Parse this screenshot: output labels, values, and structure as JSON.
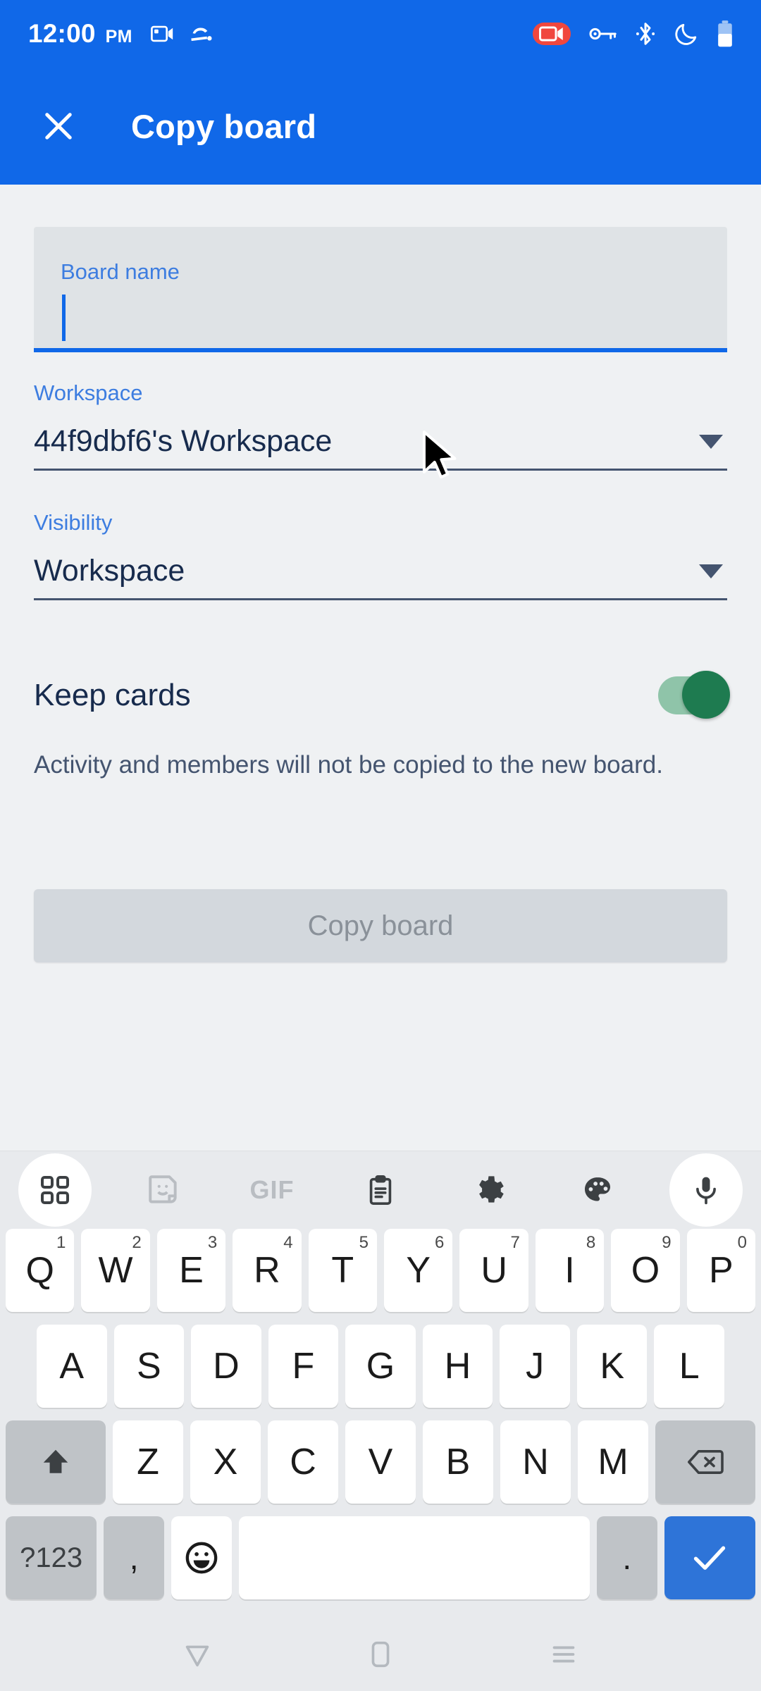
{
  "statusbar": {
    "time": "12:00",
    "ampm": "PM",
    "left_icons": [
      "video-camera-icon",
      "android-auto-icon"
    ],
    "right_icons": [
      "screen-record-icon",
      "vpn-key-icon",
      "bluetooth-icon",
      "do-not-disturb-moon-icon",
      "battery-icon"
    ],
    "accent_color": "#1068E8",
    "record_color": "#F0473E"
  },
  "appbar": {
    "close_label": "close-icon",
    "title": "Copy board"
  },
  "form": {
    "board_name": {
      "label": "Board name",
      "value": "",
      "focused": true
    },
    "workspace": {
      "label": "Workspace",
      "value": "44f9dbf6's Workspace"
    },
    "visibility": {
      "label": "Visibility",
      "value": "Workspace"
    },
    "keep_cards": {
      "label": "Keep cards",
      "enabled": true,
      "on_color": "#1E7B50",
      "track_color": "#8FC4A9"
    },
    "helper_text": "Activity and members will not be copied to the new board.",
    "submit": {
      "label": "Copy board",
      "enabled": false
    }
  },
  "keyboard": {
    "toolbar": [
      {
        "name": "grid-apps-icon",
        "circled": true
      },
      {
        "name": "sticker-icon",
        "circled": false
      },
      {
        "name": "gif-icon",
        "label": "GIF",
        "circled": false
      },
      {
        "name": "clipboard-icon",
        "circled": false
      },
      {
        "name": "gear-icon",
        "circled": false
      },
      {
        "name": "palette-icon",
        "circled": false
      },
      {
        "name": "microphone-icon",
        "circled": true
      }
    ],
    "row1": [
      {
        "key": "Q",
        "num": "1"
      },
      {
        "key": "W",
        "num": "2"
      },
      {
        "key": "E",
        "num": "3"
      },
      {
        "key": "R",
        "num": "4"
      },
      {
        "key": "T",
        "num": "5"
      },
      {
        "key": "Y",
        "num": "6"
      },
      {
        "key": "U",
        "num": "7"
      },
      {
        "key": "I",
        "num": "8"
      },
      {
        "key": "O",
        "num": "9"
      },
      {
        "key": "P",
        "num": "0"
      }
    ],
    "row2": [
      "A",
      "S",
      "D",
      "F",
      "G",
      "H",
      "J",
      "K",
      "L"
    ],
    "row3_letters": [
      "Z",
      "X",
      "C",
      "V",
      "B",
      "N",
      "M"
    ],
    "shift_label": "shift-icon",
    "backspace_label": "backspace-icon",
    "row4": {
      "symbols": "?123",
      "comma": ",",
      "emoji": "emoji-icon",
      "space": "",
      "period": ".",
      "enter": "checkmark-icon"
    }
  },
  "navbar": {
    "back": "back-triangle-icon",
    "home": "home-icon",
    "recents": "recents-icon"
  }
}
